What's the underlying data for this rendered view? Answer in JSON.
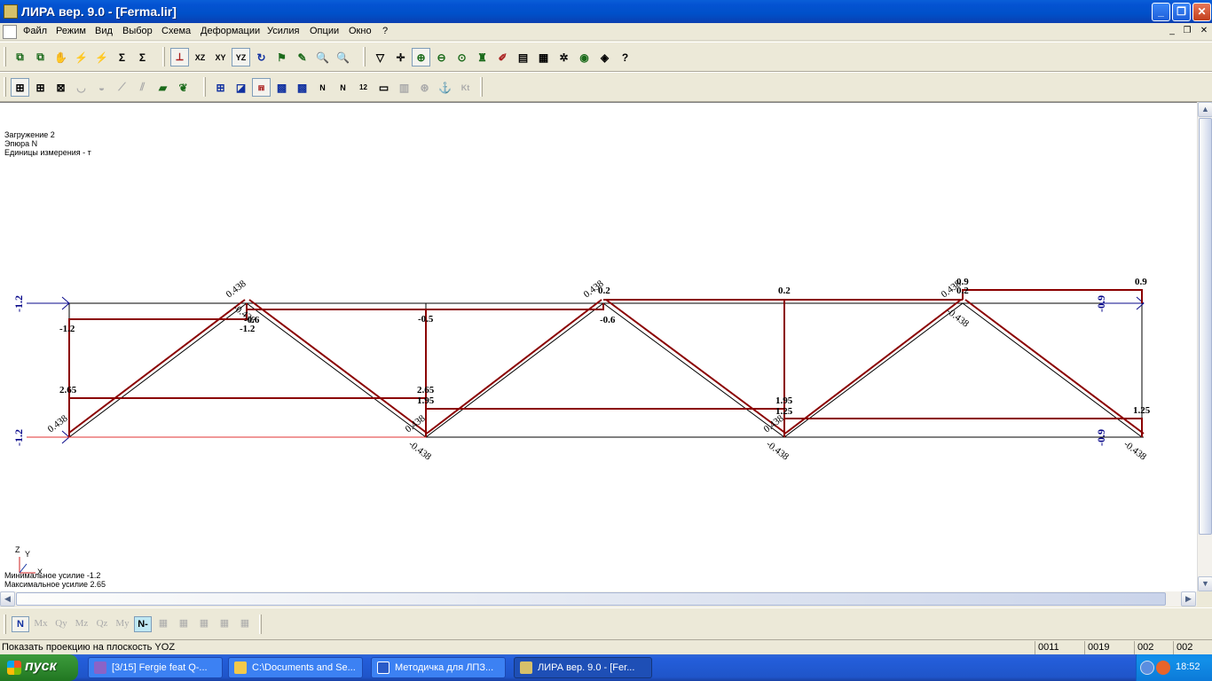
{
  "window": {
    "title": "ЛИРА  вер. 9.0 - [Ferma.lir]"
  },
  "menu": [
    "Файл",
    "Режим",
    "Вид",
    "Выбор",
    "Схема",
    "Деформации",
    "Усилия",
    "Опции",
    "Окно",
    "?"
  ],
  "canvas_info": {
    "load": "Загружение  2",
    "diagram": "Эпюра   N",
    "units": "Единицы измерения - т",
    "min": "Минимальное усилие  -1.2",
    "max": "Максимальное усилие  2.65"
  },
  "axes": {
    "z": "Z",
    "y": "Y",
    "x": "X"
  },
  "diagram_labels": {
    "left_top_support": "-1.2",
    "left_bottom_support": "-1.2",
    "right_top_support": "-0.9",
    "right_bottom_support": "-0.9",
    "n1": "-1.2",
    "n2": "-1.2",
    "n3": "-0.5",
    "n4": "0.2",
    "n5": "0.2",
    "n6": "0.9",
    "n7": "0.9",
    "n8": "0.2",
    "b1": "2.65",
    "b2": "2.65",
    "b3": "1.95",
    "b4": "1.95",
    "b5": "1.25",
    "b6": "1.25",
    "d1": "0.438",
    "d2": "0.438",
    "d3": "0.438",
    "d4": "0.438",
    "d5": "0.438",
    "d6": "-0.438",
    "d7": "-0.438",
    "d8": "-0.438",
    "d9": "-0.438",
    "d10": "0.438",
    "d11": "-0.438",
    "v1": "-0.6",
    "v2": "-0.6",
    "v3": "-0.5"
  },
  "efforts": [
    "N",
    "Mx",
    "Qy",
    "Mz",
    "Qz",
    "My",
    "N-"
  ],
  "status": {
    "message": "Показать проекцию на плоскость YOZ",
    "panes": [
      "0011",
      "0019",
      "002",
      "002"
    ]
  },
  "taskbar": {
    "start": "пуск",
    "tasks": [
      "[3/15] Fergie feat Q-...",
      "C:\\Documents and Se...",
      "Методичка для ЛПЗ...",
      "ЛИРА  вер. 9.0 - [Fer..."
    ],
    "clock": "18:52"
  },
  "colors": {
    "diagram": "#8b0000",
    "truss": "#000000",
    "support_load": "#0a0a8b",
    "accent": "#0050c9"
  }
}
